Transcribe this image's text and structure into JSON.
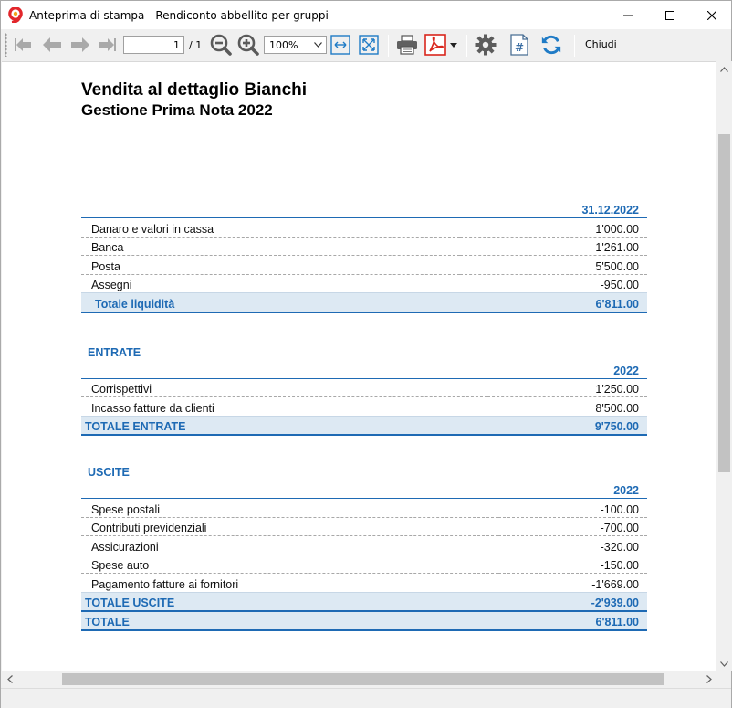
{
  "window": {
    "title": "Anteprima di stampa - Rendiconto abbellito per gruppi"
  },
  "toolbar": {
    "page_current": "1",
    "page_total": "/ 1",
    "zoom": "100%",
    "close_label": "Chiudi"
  },
  "colors": {
    "accent": "#1e6ab4",
    "total_bg": "#dde9f3",
    "pdf_red": "#d9261c"
  },
  "report": {
    "company": "Vendita al dettaglio Bianchi",
    "subtitle": "Gestione Prima Nota 2022",
    "liquidity": {
      "column_header": "31.12.2022",
      "rows": [
        {
          "desc": "Danaro e valori in cassa",
          "value": "1'000.00"
        },
        {
          "desc": "Banca",
          "value": "1'261.00"
        },
        {
          "desc": "Posta",
          "value": "5'500.00"
        },
        {
          "desc": "Assegni",
          "value": "-950.00"
        }
      ],
      "total_label": "Totale liquidità",
      "total_value": "6'811.00"
    },
    "income": {
      "title": "ENTRATE",
      "column_header": "2022",
      "rows": [
        {
          "desc": "Corrispettivi",
          "value": "1'250.00"
        },
        {
          "desc": "Incasso fatture da clienti",
          "value": "8'500.00"
        }
      ],
      "total_label": "TOTALE ENTRATE",
      "total_value": "9'750.00"
    },
    "expenses": {
      "title": "USCITE",
      "column_header": "2022",
      "rows": [
        {
          "desc": "Spese postali",
          "value": "-100.00"
        },
        {
          "desc": "Contributi previdenziali",
          "value": "-700.00"
        },
        {
          "desc": "Assicurazioni",
          "value": "-320.00"
        },
        {
          "desc": "Spese auto",
          "value": "-150.00"
        },
        {
          "desc": "Pagamento fatture ai fornitori",
          "value": "-1'669.00"
        }
      ],
      "total_label": "TOTALE USCITE",
      "total_value": "-2'939.00"
    },
    "grand_total": {
      "label": "TOTALE",
      "value": "6'811.00"
    }
  }
}
